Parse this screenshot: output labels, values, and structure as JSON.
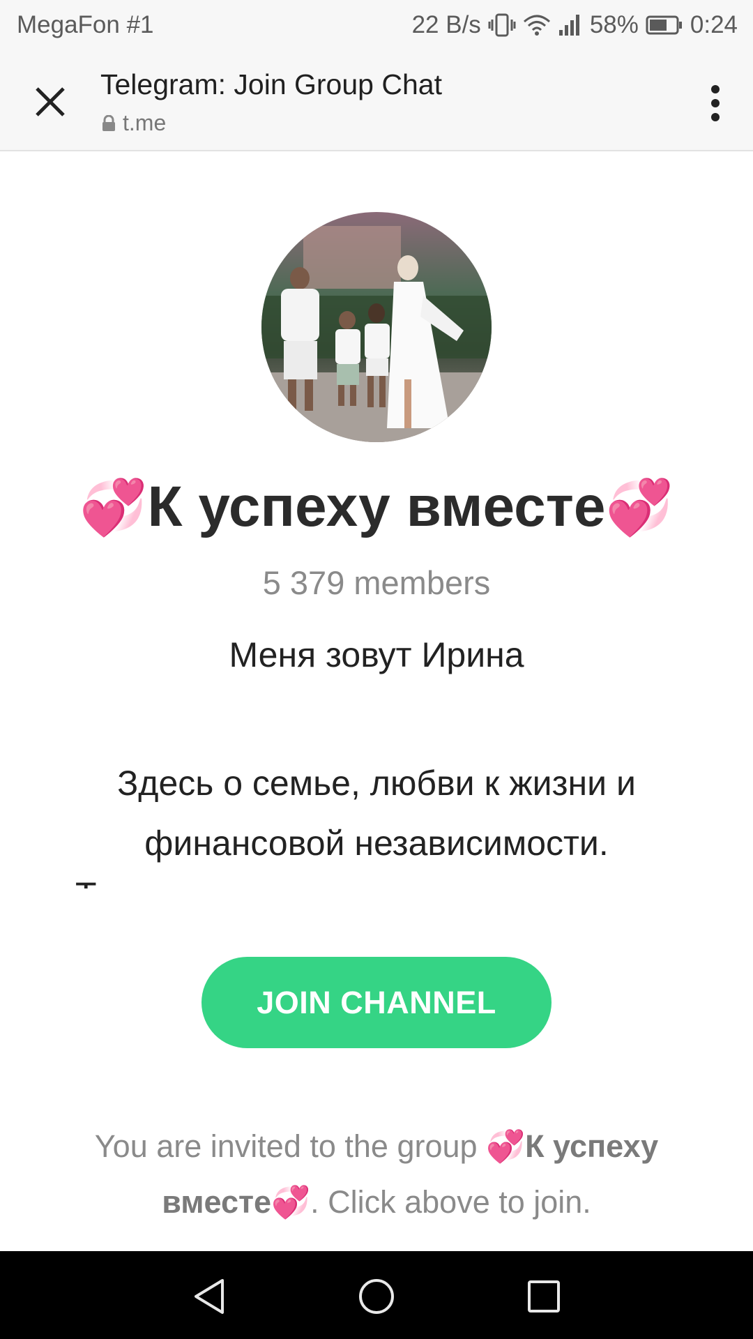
{
  "status_bar": {
    "carrier": "MegaFon #1",
    "speed": "22 B/s",
    "battery": "58%",
    "time": "0:24"
  },
  "toolbar": {
    "title": "Telegram: Join Group Chat",
    "url": "t.me"
  },
  "group": {
    "heart_left": "💞",
    "name": "К успеху вместе",
    "heart_right": "💞",
    "members": "5 379 members",
    "description_line1": "Меня зовут Ирина",
    "description_line2": "Здесь о семье, любви к жизни и финансовой независимости.",
    "description_cut": "Т"
  },
  "join_button": {
    "label": "JOIN CHANNEL"
  },
  "invite": {
    "prefix": "You are invited to the group ",
    "heart_left": "💞",
    "group_name": "К успеху вместе",
    "heart_right": "💞",
    "suffix": ". Click above to join."
  },
  "colors": {
    "join_button": "#35d485",
    "status_bar_bg": "#f7f7f7",
    "nav_bar_bg": "#000000"
  }
}
